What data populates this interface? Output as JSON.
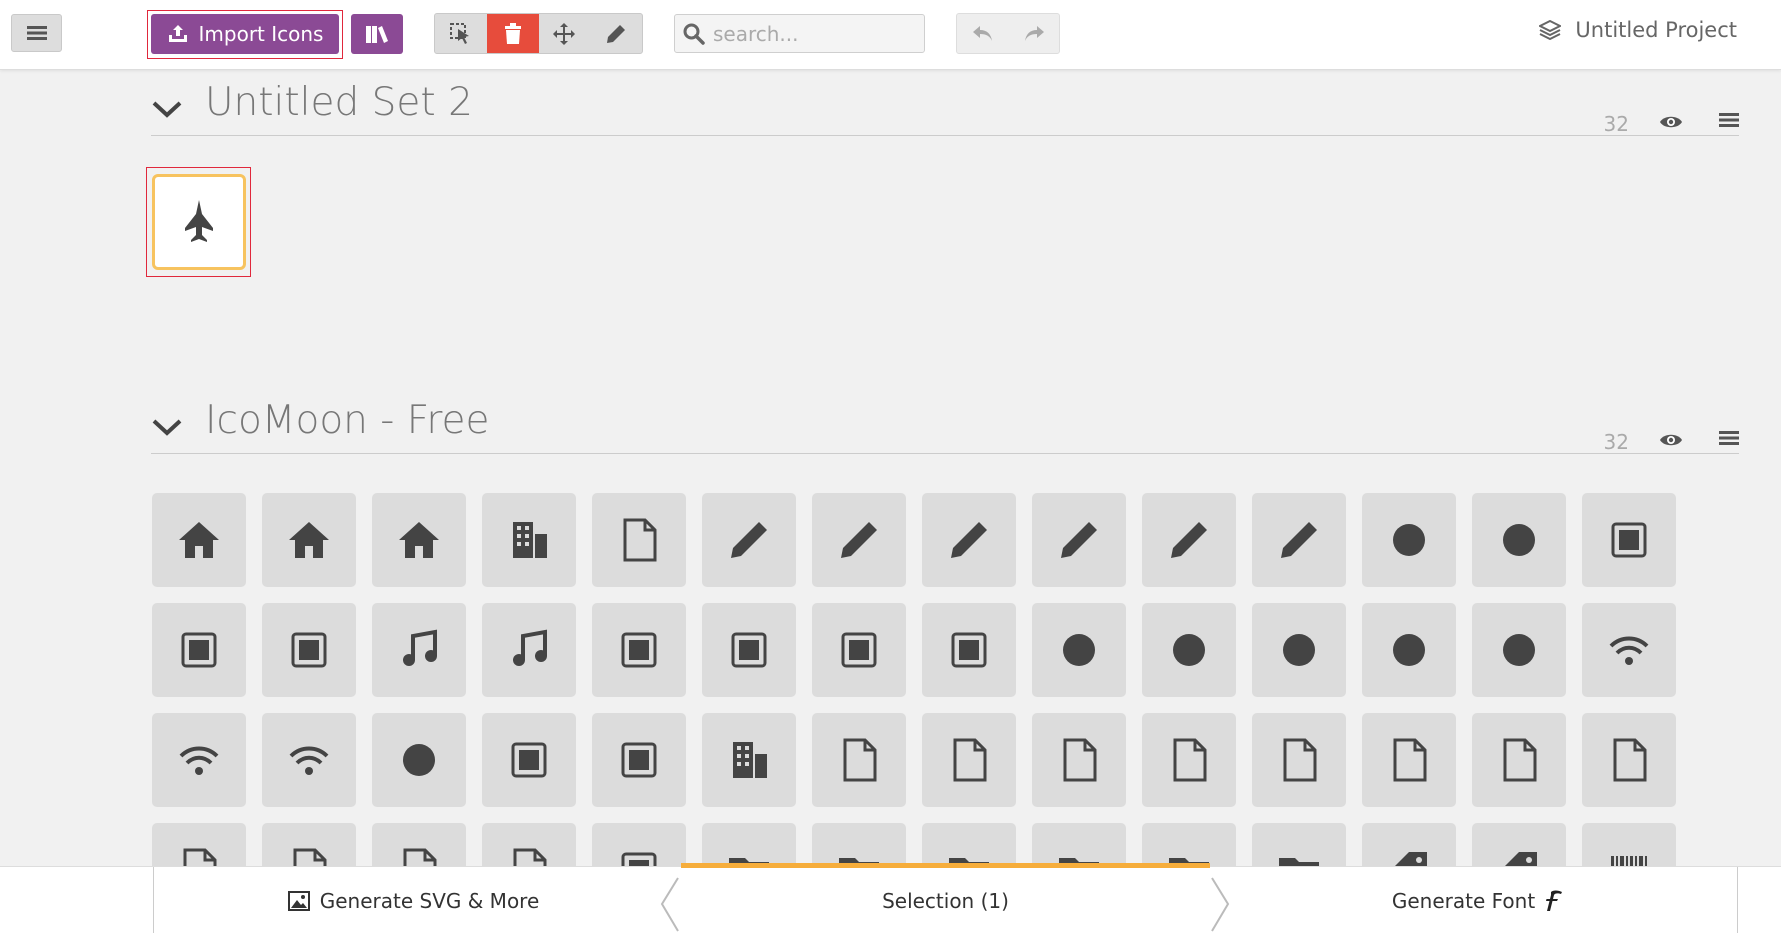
{
  "toolbar": {
    "import_label": "Import Icons",
    "search_placeholder": "search...",
    "project_name": "Untitled Project"
  },
  "sets": [
    {
      "title": "Untitled Set 2",
      "size": "32"
    },
    {
      "title": "IcoMoon - Free",
      "size": "32"
    }
  ],
  "selected_icon": "fighter-jet-icon",
  "icomoon_icons": [
    "home-icon",
    "home2-icon",
    "home3-icon",
    "office-icon",
    "newspaper-icon",
    "pencil-icon",
    "pencil2-icon",
    "quill-icon",
    "pen-icon",
    "blog-icon",
    "eyedropper-icon",
    "droplet-icon",
    "paint-format-icon",
    "image-icon",
    "images-icon",
    "camera-icon",
    "headphones-icon",
    "music-icon",
    "play-icon",
    "film-icon",
    "video-camera-icon",
    "dice-icon",
    "pacman-icon",
    "spades-icon",
    "clubs-icon",
    "diamonds-icon",
    "bullhorn-icon",
    "connection-icon",
    "podcast-icon",
    "feed-icon",
    "mic-icon",
    "book-icon",
    "books-icon",
    "library-icon",
    "file-text-icon",
    "profile-icon",
    "file-empty-icon",
    "files-empty-icon",
    "file-text2-icon",
    "file-picture-icon",
    "file-music-icon",
    "file-play-icon",
    "file-video-icon",
    "file-zip-icon",
    "copy-icon",
    "paste-icon",
    "stack-icon",
    "folder-icon",
    "folder-open-icon",
    "folder-plus-icon",
    "folder-minus-icon",
    "folder-download-icon",
    "folder-upload-icon",
    "price-tag-icon",
    "price-tags-icon",
    "barcode-icon"
  ],
  "bottom": {
    "left_label": "Generate SVG & More",
    "mid_label": "Selection (1)",
    "right_label": "Generate Font"
  },
  "colors": {
    "accent": "#8b4a95",
    "delete": "#e74c3c",
    "selection": "#f6ad3b"
  }
}
